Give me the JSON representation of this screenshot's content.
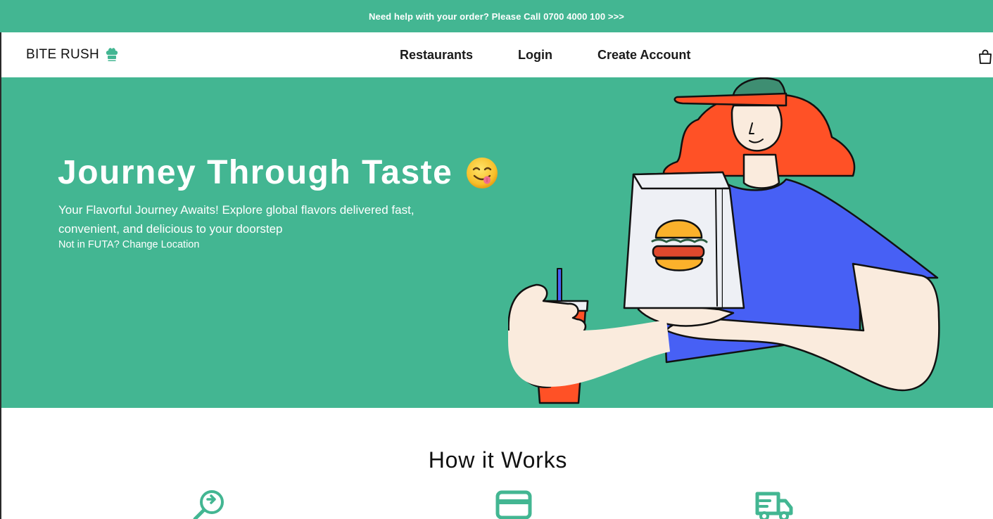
{
  "topbar": {
    "help_text": "Need help with your order? Please Call 0700 4000 100 >>>"
  },
  "nav": {
    "brand": "BITE RUSH",
    "links": {
      "restaurants": "Restaurants",
      "login": "Login",
      "create_account": "Create Account"
    },
    "icons": {
      "logo": "chef-hat-icon",
      "cart": "shopping-bag-icon"
    }
  },
  "hero": {
    "title": "Journey Through Taste",
    "emoji": "yum-face-emoji",
    "subtitle": "Your Flavorful Journey Awaits! Explore global flavors delivered fast, convenient, and delicious to your doorstep",
    "location_text": "Not in FUTA? Change Location",
    "illustration": "woman-holding-burger-bag-and-drink"
  },
  "how_it_works": {
    "title": "How it Works",
    "step_icons": [
      "location-search-icon",
      "credit-card-icon",
      "delivery-truck-icon"
    ]
  },
  "colors": {
    "brand_green": "#43B692",
    "hair": "#FF5126",
    "shirt": "#4760F5",
    "burger": "#FBB12B"
  }
}
